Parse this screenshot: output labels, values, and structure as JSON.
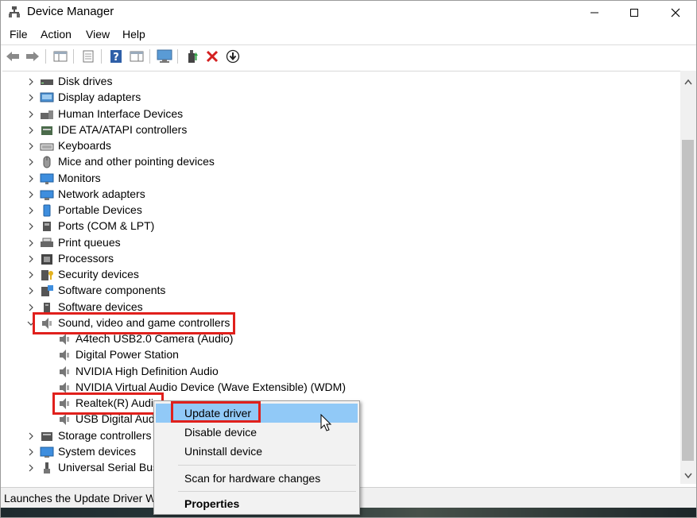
{
  "window": {
    "title": "Device Manager"
  },
  "menu": [
    "File",
    "Action",
    "View",
    "Help"
  ],
  "tree": {
    "categories": [
      {
        "label": "Disk drives",
        "icon": "disk-drive-icon"
      },
      {
        "label": "Display adapters",
        "icon": "display-adapter-icon"
      },
      {
        "label": "Human Interface Devices",
        "icon": "hid-icon"
      },
      {
        "label": "IDE ATA/ATAPI controllers",
        "icon": "ide-controller-icon"
      },
      {
        "label": "Keyboards",
        "icon": "keyboard-icon"
      },
      {
        "label": "Mice and other pointing devices",
        "icon": "mouse-icon"
      },
      {
        "label": "Monitors",
        "icon": "monitor-icon"
      },
      {
        "label": "Network adapters",
        "icon": "network-adapter-icon"
      },
      {
        "label": "Portable Devices",
        "icon": "portable-device-icon"
      },
      {
        "label": "Ports (COM & LPT)",
        "icon": "port-icon"
      },
      {
        "label": "Print queues",
        "icon": "printer-icon"
      },
      {
        "label": "Processors",
        "icon": "processor-icon"
      },
      {
        "label": "Security devices",
        "icon": "security-device-icon"
      },
      {
        "label": "Software components",
        "icon": "software-component-icon"
      },
      {
        "label": "Software devices",
        "icon": "software-device-icon"
      }
    ],
    "expanded": {
      "label": "Sound, video and game controllers",
      "children": [
        "A4tech USB2.0 Camera (Audio)",
        "Digital Power Station",
        "NVIDIA High Definition Audio",
        "NVIDIA Virtual Audio Device (Wave Extensible) (WDM)",
        "Realtek(R) Audio",
        "USB Digital Audio"
      ]
    },
    "after": [
      {
        "label": "Storage controllers",
        "icon": "storage-controller-icon"
      },
      {
        "label": "System devices",
        "icon": "system-device-icon"
      },
      {
        "label": "Universal Serial Bus controllers",
        "icon": "usb-icon"
      }
    ]
  },
  "context_menu": {
    "items": [
      "Update driver",
      "Disable device",
      "Uninstall device",
      "Scan for hardware changes",
      "Properties"
    ],
    "highlighted": "Update driver"
  },
  "status": {
    "text": "Launches the Update Driver Wizard for the selected device."
  },
  "colors": {
    "highlight_box": "#e0201c",
    "menu_hover": "#91c9f7"
  }
}
